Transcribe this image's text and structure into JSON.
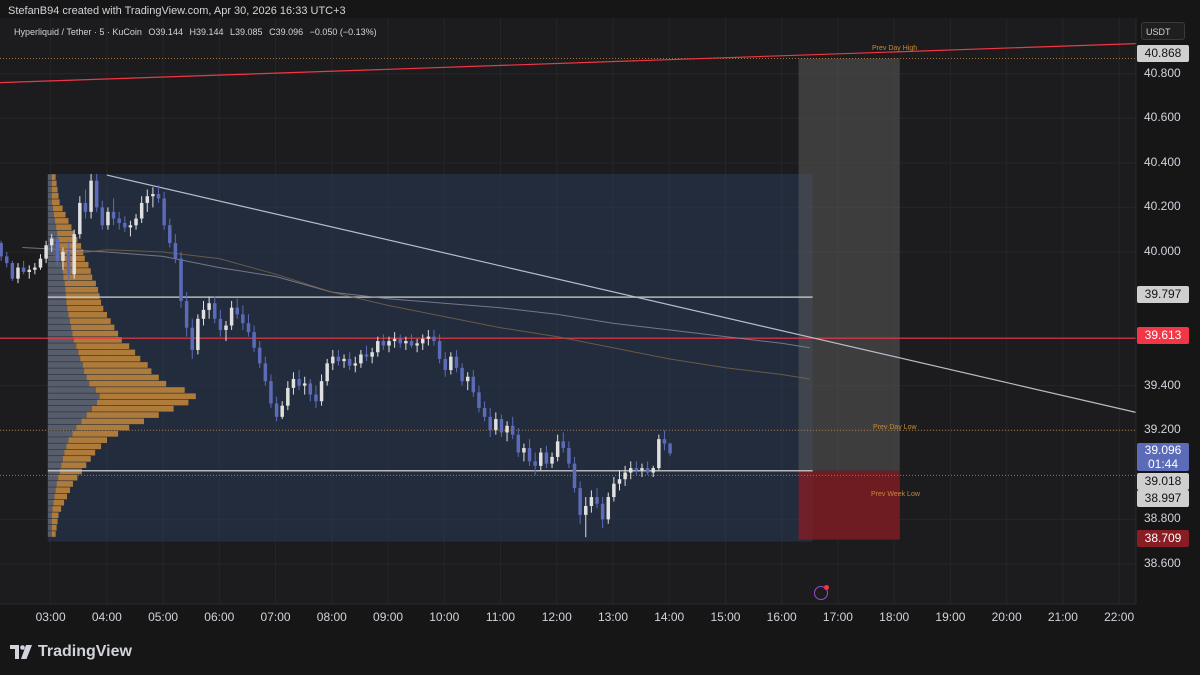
{
  "header": {
    "credit": "StefanB94 created with TradingView.com, Apr 30, 2026 16:33 UTC+3",
    "symbol": "Hyperliquid / Tether · 5 · KuCoin",
    "open": "O39.144",
    "high": "H39.144",
    "low": "L39.085",
    "close": "C39.096",
    "change": "−0.050 (−0.13%)"
  },
  "currency_label": "USDT",
  "brand": "TradingView",
  "price_tags": {
    "prev_day_high": "40.868",
    "line_a": "39.797",
    "line_b": "39.613",
    "last_price": "39.096",
    "countdown": "01:44",
    "line_c": "39.018",
    "prev_week_low": "38.997",
    "bottom": "38.709"
  },
  "zone_labels": {
    "prev_day_high": "Prev Day High",
    "prev_day_low": "Prev Day Low",
    "prev_week_low": "Prev Week Low"
  },
  "colors": {
    "background": "#161616",
    "bull": "#e0e0e0",
    "bear": "#5b6bb8",
    "profile": "#c8893a",
    "red_line": "#f23645",
    "white_line": "#d0d0d0"
  },
  "chart_data": {
    "type": "candlestick",
    "symbol": "Hyperliquid / Tether",
    "interval": "5",
    "exchange": "KuCoin",
    "x_tick_labels": [
      "03:00",
      "04:00",
      "05:00",
      "06:00",
      "07:00",
      "08:00",
      "09:00",
      "10:00",
      "11:00",
      "12:00",
      "13:00",
      "14:00",
      "15:00",
      "16:00",
      "17:00",
      "18:00",
      "19:00",
      "20:00",
      "21:00",
      "22:00"
    ],
    "y_tick_labels": [
      "40.800",
      "40.600",
      "40.400",
      "40.200",
      "40.000",
      "39.400",
      "39.200",
      "38.800",
      "38.600"
    ],
    "ylim": [
      38.42,
      41.05
    ],
    "x_hours_range": [
      2.1,
      22.3
    ],
    "horizontal_levels": [
      {
        "name": "Prev Day High",
        "price": 40.868,
        "style": "dotted",
        "color": "#c8893a"
      },
      {
        "name": "Prev Day Low",
        "price": 39.2,
        "style": "dotted",
        "color": "#c8893a"
      },
      {
        "name": "Prev Week Low",
        "price": 38.997,
        "style": "dotted",
        "color": "#c8893a"
      },
      {
        "price": 39.797,
        "style": "solid",
        "color": "#d0d0d0"
      },
      {
        "price": 39.613,
        "style": "solid",
        "color": "#f23645"
      },
      {
        "price": 39.018,
        "style": "solid",
        "color": "#d0d0d0"
      }
    ],
    "trendlines": [
      {
        "from": {
          "hour": 2.1,
          "price": 40.76
        },
        "to": {
          "hour": 22.3,
          "price": 40.935
        },
        "color": "#f23645"
      },
      {
        "from": {
          "hour": 4.0,
          "price": 40.345
        },
        "to": {
          "hour": 22.3,
          "price": 39.28
        },
        "color": "#b8bcc8"
      }
    ],
    "candles_hour_start": 2.12,
    "candles_interval_hours": 0.0833,
    "candles": [
      [
        40.04,
        40.05,
        39.96,
        39.98
      ],
      [
        39.98,
        40.0,
        39.93,
        39.95
      ],
      [
        39.95,
        39.96,
        39.87,
        39.88
      ],
      [
        39.88,
        39.95,
        39.86,
        39.93
      ],
      [
        39.93,
        39.96,
        39.9,
        39.91
      ],
      [
        39.91,
        39.94,
        39.88,
        39.92
      ],
      [
        39.92,
        39.95,
        39.9,
        39.93
      ],
      [
        39.93,
        39.99,
        39.92,
        39.97
      ],
      [
        39.97,
        40.05,
        39.95,
        40.03
      ],
      [
        40.03,
        40.08,
        40.0,
        40.06
      ],
      [
        40.06,
        40.08,
        39.94,
        39.96
      ],
      [
        39.96,
        40.02,
        39.92,
        40.0
      ],
      [
        40.0,
        40.05,
        39.87,
        39.9
      ],
      [
        39.9,
        40.1,
        39.88,
        40.08
      ],
      [
        40.08,
        40.25,
        40.06,
        40.22
      ],
      [
        40.22,
        40.28,
        40.15,
        40.18
      ],
      [
        40.18,
        40.35,
        40.15,
        40.32
      ],
      [
        40.32,
        40.35,
        40.18,
        40.2
      ],
      [
        40.2,
        40.23,
        40.1,
        40.12
      ],
      [
        40.12,
        40.2,
        40.1,
        40.18
      ],
      [
        40.18,
        40.24,
        40.12,
        40.15
      ],
      [
        40.15,
        40.18,
        40.1,
        40.13
      ],
      [
        40.13,
        40.16,
        40.09,
        40.11
      ],
      [
        40.11,
        40.14,
        40.07,
        40.12
      ],
      [
        40.12,
        40.17,
        40.1,
        40.15
      ],
      [
        40.15,
        40.25,
        40.13,
        40.22
      ],
      [
        40.22,
        40.28,
        40.18,
        40.25
      ],
      [
        40.25,
        40.29,
        40.2,
        40.26
      ],
      [
        40.26,
        40.3,
        40.22,
        40.24
      ],
      [
        40.24,
        40.27,
        40.1,
        40.12
      ],
      [
        40.12,
        40.15,
        40.02,
        40.04
      ],
      [
        40.04,
        40.08,
        39.95,
        39.97
      ],
      [
        39.97,
        40.0,
        39.75,
        39.78
      ],
      [
        39.78,
        39.82,
        39.62,
        39.66
      ],
      [
        39.66,
        39.7,
        39.52,
        39.56
      ],
      [
        39.56,
        39.72,
        39.54,
        39.7
      ],
      [
        39.7,
        39.78,
        39.67,
        39.74
      ],
      [
        39.74,
        39.8,
        39.7,
        39.77
      ],
      [
        39.77,
        39.8,
        39.68,
        39.7
      ],
      [
        39.7,
        39.74,
        39.62,
        39.65
      ],
      [
        39.65,
        39.69,
        39.6,
        39.67
      ],
      [
        39.67,
        39.78,
        39.65,
        39.75
      ],
      [
        39.75,
        39.79,
        39.7,
        39.72
      ],
      [
        39.72,
        39.76,
        39.65,
        39.68
      ],
      [
        39.68,
        39.72,
        39.62,
        39.64
      ],
      [
        39.64,
        39.67,
        39.55,
        39.57
      ],
      [
        39.57,
        39.6,
        39.48,
        39.5
      ],
      [
        39.5,
        39.53,
        39.4,
        39.42
      ],
      [
        39.42,
        39.45,
        39.3,
        39.32
      ],
      [
        39.32,
        39.35,
        39.24,
        39.26
      ],
      [
        39.26,
        39.33,
        39.25,
        39.31
      ],
      [
        39.31,
        39.42,
        39.29,
        39.39
      ],
      [
        39.39,
        39.46,
        39.36,
        39.43
      ],
      [
        39.43,
        39.47,
        39.38,
        39.4
      ],
      [
        39.4,
        39.44,
        39.36,
        39.41
      ],
      [
        39.41,
        39.43,
        39.33,
        39.36
      ],
      [
        39.36,
        39.4,
        39.3,
        39.33
      ],
      [
        39.33,
        39.45,
        39.31,
        39.42
      ],
      [
        39.42,
        39.52,
        39.4,
        39.5
      ],
      [
        39.5,
        39.56,
        39.47,
        39.53
      ],
      [
        39.53,
        39.56,
        39.49,
        39.51
      ],
      [
        39.51,
        39.54,
        39.48,
        39.52
      ],
      [
        39.52,
        39.55,
        39.47,
        39.49
      ],
      [
        39.49,
        39.53,
        39.46,
        39.5
      ],
      [
        39.5,
        39.56,
        39.48,
        39.54
      ],
      [
        39.54,
        39.58,
        39.51,
        39.53
      ],
      [
        39.53,
        39.57,
        39.5,
        39.55
      ],
      [
        39.55,
        39.62,
        39.53,
        39.6
      ],
      [
        39.6,
        39.63,
        39.56,
        39.58
      ],
      [
        39.58,
        39.62,
        39.55,
        39.6
      ],
      [
        39.6,
        39.64,
        39.57,
        39.61
      ],
      [
        39.61,
        39.63,
        39.57,
        39.59
      ],
      [
        39.59,
        39.62,
        39.56,
        39.6
      ],
      [
        39.6,
        39.63,
        39.57,
        39.58
      ],
      [
        39.58,
        39.61,
        39.55,
        39.59
      ],
      [
        39.59,
        39.63,
        39.56,
        39.61
      ],
      [
        39.61,
        39.65,
        39.58,
        39.62
      ],
      [
        39.62,
        39.65,
        39.58,
        39.6
      ],
      [
        39.6,
        39.63,
        39.5,
        39.52
      ],
      [
        39.52,
        39.55,
        39.44,
        39.47
      ],
      [
        39.47,
        39.55,
        39.45,
        39.53
      ],
      [
        39.53,
        39.56,
        39.46,
        39.48
      ],
      [
        39.48,
        39.5,
        39.4,
        39.42
      ],
      [
        39.42,
        39.46,
        39.38,
        39.44
      ],
      [
        39.44,
        39.47,
        39.35,
        39.37
      ],
      [
        39.37,
        39.4,
        39.28,
        39.3
      ],
      [
        39.3,
        39.33,
        39.24,
        39.26
      ],
      [
        39.26,
        39.3,
        39.17,
        39.2
      ],
      [
        39.2,
        39.28,
        39.18,
        39.25
      ],
      [
        39.25,
        39.27,
        39.17,
        39.19
      ],
      [
        39.19,
        39.24,
        39.15,
        39.22
      ],
      [
        39.22,
        39.26,
        39.16,
        39.18
      ],
      [
        39.18,
        39.21,
        39.08,
        39.1
      ],
      [
        39.1,
        39.14,
        39.06,
        39.12
      ],
      [
        39.12,
        39.16,
        39.04,
        39.06
      ],
      [
        39.06,
        39.1,
        39.0,
        39.04
      ],
      [
        39.04,
        39.12,
        39.02,
        39.1
      ],
      [
        39.1,
        39.13,
        39.03,
        39.05
      ],
      [
        39.05,
        39.1,
        39.03,
        39.08
      ],
      [
        39.08,
        39.18,
        39.06,
        39.15
      ],
      [
        39.15,
        39.19,
        39.1,
        39.12
      ],
      [
        39.12,
        39.15,
        39.03,
        39.05
      ],
      [
        39.05,
        39.08,
        38.92,
        38.94
      ],
      [
        38.94,
        38.97,
        38.78,
        38.82
      ],
      [
        38.82,
        38.9,
        38.72,
        38.86
      ],
      [
        38.86,
        38.93,
        38.83,
        38.9
      ],
      [
        38.9,
        38.94,
        38.85,
        38.87
      ],
      [
        38.87,
        38.9,
        38.76,
        38.8
      ],
      [
        38.8,
        38.92,
        38.78,
        38.9
      ],
      [
        38.9,
        38.99,
        38.88,
        38.96
      ],
      [
        38.96,
        39.02,
        38.93,
        38.98
      ],
      [
        38.98,
        39.04,
        38.95,
        39.01
      ],
      [
        39.01,
        39.06,
        38.98,
        39.03
      ],
      [
        39.03,
        39.06,
        39.0,
        39.02
      ],
      [
        39.02,
        39.05,
        38.99,
        39.03
      ],
      [
        39.03,
        39.06,
        39.0,
        39.01
      ],
      [
        39.01,
        39.04,
        38.99,
        39.03
      ],
      [
        39.03,
        39.18,
        39.02,
        39.16
      ],
      [
        39.16,
        39.2,
        39.11,
        39.14
      ],
      [
        39.14,
        39.144,
        39.085,
        39.096
      ]
    ],
    "moving_averages": [
      {
        "name": "MA slow",
        "color": "#8a8a9a",
        "points": [
          [
            2.5,
            40.02
          ],
          [
            4.0,
            40.0
          ],
          [
            5.0,
            39.98
          ],
          [
            6.0,
            39.93
          ],
          [
            7.0,
            39.89
          ],
          [
            8.0,
            39.82
          ],
          [
            9.0,
            39.79
          ],
          [
            10.0,
            39.77
          ],
          [
            11.0,
            39.75
          ],
          [
            12.0,
            39.72
          ],
          [
            13.0,
            39.68
          ],
          [
            14.0,
            39.65
          ],
          [
            15.0,
            39.62
          ],
          [
            16.0,
            39.59
          ],
          [
            16.5,
            39.57
          ]
        ]
      },
      {
        "name": "MA fast",
        "color": "#7a6548",
        "points": [
          [
            3.0,
            39.98
          ],
          [
            4.0,
            40.01
          ],
          [
            5.0,
            40.0
          ],
          [
            6.0,
            39.97
          ],
          [
            7.0,
            39.9
          ],
          [
            8.0,
            39.82
          ],
          [
            9.0,
            39.76
          ],
          [
            10.0,
            39.71
          ],
          [
            11.0,
            39.66
          ],
          [
            12.0,
            39.62
          ],
          [
            13.0,
            39.57
          ],
          [
            14.0,
            39.52
          ],
          [
            15.0,
            39.48
          ],
          [
            16.0,
            39.45
          ],
          [
            16.5,
            39.43
          ]
        ]
      }
    ],
    "volume_profile": {
      "from_price": 38.72,
      "to_price": 40.35,
      "bins": [
        8,
        10,
        12,
        14,
        18,
        22,
        26,
        30,
        34,
        40,
        46,
        52,
        58,
        64,
        72,
        80,
        95,
        110,
        130,
        150,
        170,
        190,
        200,
        185,
        160,
        150,
        140,
        135,
        125,
        118,
        110,
        100,
        95,
        90,
        85,
        80,
        75,
        72,
        70,
        68,
        65,
        60,
        58,
        55,
        50,
        48,
        45,
        40,
        36,
        32,
        28,
        24,
        20,
        16,
        14,
        12,
        10,
        8
      ]
    },
    "annotations": [
      {
        "type": "range_box",
        "from_hour": 2.95,
        "to_hour": 16.55,
        "from_price": 38.7,
        "to_price": 40.35,
        "color": "#2a3a55"
      },
      {
        "type": "projection_box",
        "from_hour": 16.3,
        "to_hour": 18.1,
        "from_price": 39.018,
        "to_price": 40.868,
        "color": "#5a5a5a"
      },
      {
        "type": "projection_box",
        "from_hour": 16.3,
        "to_hour": 18.1,
        "from_price": 38.709,
        "to_price": 39.018,
        "color": "#8a1c24"
      }
    ]
  }
}
